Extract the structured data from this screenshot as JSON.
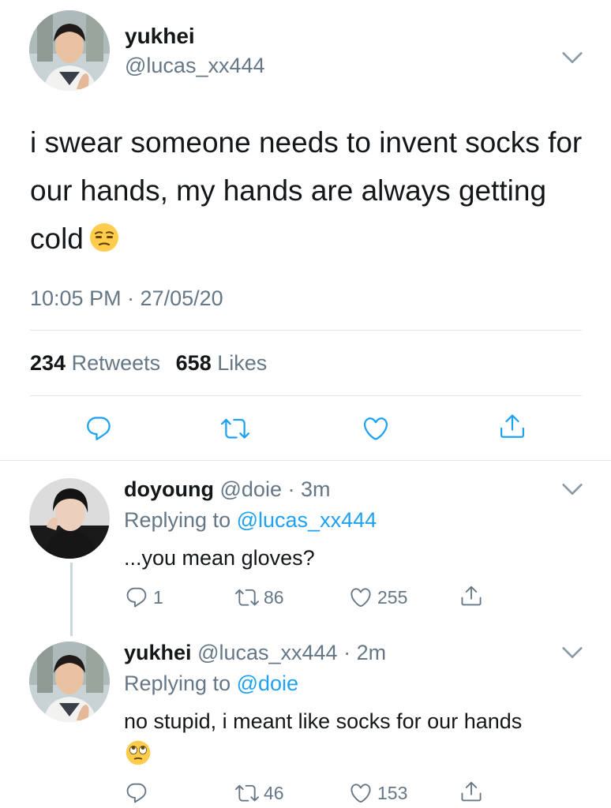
{
  "main_tweet": {
    "display_name": "yukhei",
    "handle": "@lucas_xx444",
    "text": "i swear someone needs to invent socks for our hands, my hands are always getting cold",
    "emoji": "unamused-face-emoji",
    "timestamp": "10:05 PM · 27/05/20",
    "retweet_count": "234",
    "retweet_label": "Retweets",
    "like_count": "658",
    "like_label": "Likes",
    "actions": [
      "reply-icon",
      "retweet-icon",
      "like-icon",
      "share-icon"
    ]
  },
  "replies": [
    {
      "display_name": "doyoung",
      "handle": "@doie",
      "age": "· 3m",
      "replying_to_label": "Replying to",
      "replying_to": "@lucas_xx444",
      "text": "...you mean gloves?",
      "reply_count": "1",
      "retweet_count": "86",
      "like_count": "255"
    },
    {
      "display_name": "yukhei",
      "handle": "@lucas_xx444",
      "age": "· 2m",
      "replying_to_label": "Replying to",
      "replying_to": "@doie",
      "text": "no stupid, i meant like socks for our hands",
      "emoji": "face-with-rolling-eyes-emoji",
      "reply_count": "",
      "retweet_count": "46",
      "like_count": "153"
    }
  ],
  "colors": {
    "text": "#14171a",
    "muted": "#657786",
    "link": "#1da1f2",
    "divider": "#e1e8ed"
  }
}
